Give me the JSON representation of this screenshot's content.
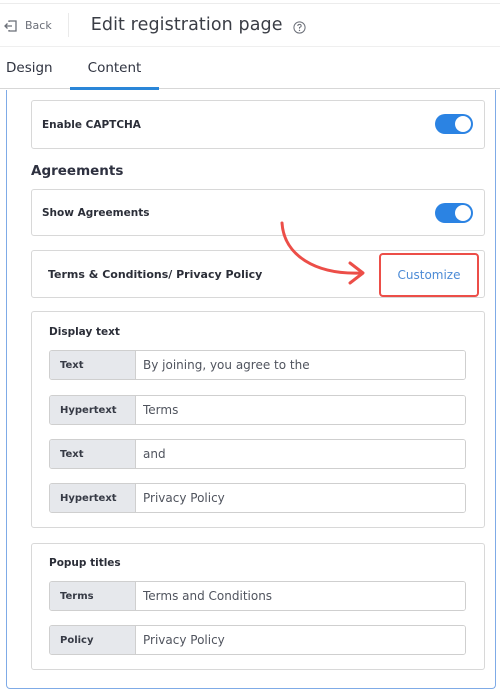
{
  "header": {
    "back_label": "Back",
    "back_icon": "exit-arrow-icon",
    "title": "Edit registration page",
    "help_icon": "question-circle-icon"
  },
  "tabs": [
    {
      "label": "Design",
      "active": false
    },
    {
      "label": "Content",
      "active": true
    }
  ],
  "settings": {
    "captcha": {
      "label": "Enable CAPTCHA",
      "enabled": true
    },
    "agreements_heading": "Agreements",
    "show_agreements": {
      "label": "Show Agreements",
      "enabled": true
    },
    "terms_row": {
      "label": "Terms & Conditions/ Privacy Policy",
      "customize_label": "Customize"
    }
  },
  "display_text": {
    "title": "Display text",
    "fields": [
      {
        "addon": "Text",
        "value": "By joining, you agree to the"
      },
      {
        "addon": "Hypertext",
        "value": "Terms"
      },
      {
        "addon": "Text",
        "value": "and"
      },
      {
        "addon": "Hypertext",
        "value": "Privacy Policy"
      }
    ]
  },
  "popup_titles": {
    "title": "Popup titles",
    "fields": [
      {
        "addon": "Terms",
        "value": "Terms and Conditions"
      },
      {
        "addon": "Policy",
        "value": "Privacy Policy"
      }
    ]
  },
  "colors": {
    "accent": "#2b83e3",
    "highlight": "#ec4e48",
    "link": "#4c8bd6",
    "panel_border": "#7fabe7"
  }
}
